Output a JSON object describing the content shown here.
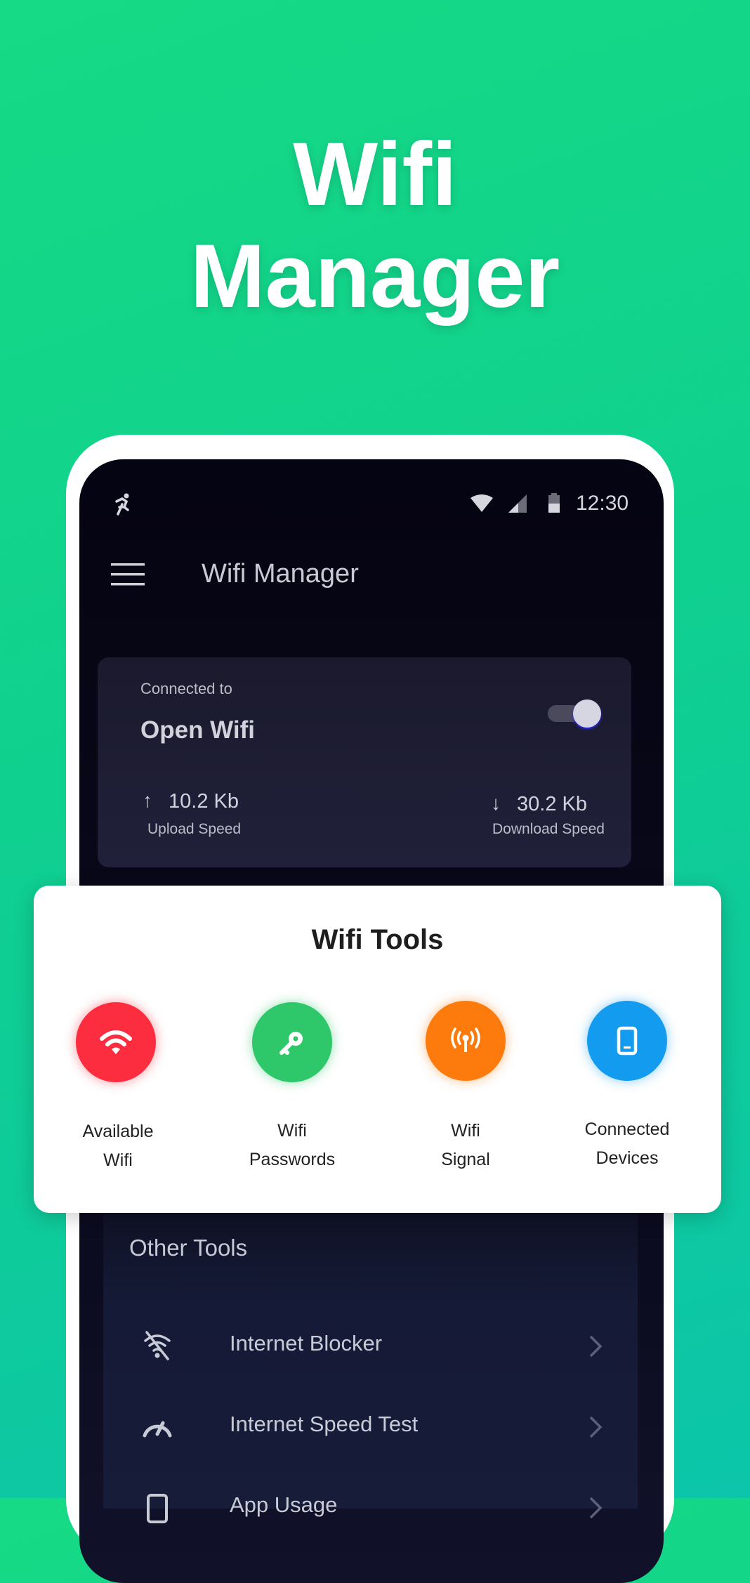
{
  "hero": {
    "line1": "Wifi",
    "line2": "Manager"
  },
  "status_bar": {
    "time": "12:30",
    "icons": [
      "running-app-icon",
      "wifi-icon",
      "cellular-signal-icon",
      "battery-icon"
    ]
  },
  "app_bar": {
    "title": "Wifi Manager",
    "menu_icon": "hamburger-icon"
  },
  "connection": {
    "label": "Connected to",
    "network": "Open Wifi",
    "toggle_on": true,
    "upload": {
      "value": "10.2 Kb",
      "label": "Upload Speed"
    },
    "download": {
      "value": "30.2 Kb",
      "label": "Download Speed"
    }
  },
  "wifi_tools": {
    "title": "Wifi Tools",
    "items": [
      {
        "line1": "Available",
        "line2": "Wifi",
        "color": "#fb2d3e",
        "icon": "wifi-icon"
      },
      {
        "line1": "Wifi",
        "line2": "Passwords",
        "color": "#2ec76a",
        "icon": "key-icon"
      },
      {
        "line1": "Wifi",
        "line2": "Signal",
        "color": "#fd7a0c",
        "icon": "antenna-signal-icon"
      },
      {
        "line1": "Connected",
        "line2": "Devices",
        "color": "#139bf0",
        "icon": "phone-icon"
      }
    ]
  },
  "other_tools": {
    "title": "Other Tools",
    "items": [
      {
        "label": "Internet Blocker",
        "icon": "wifi-off-icon"
      },
      {
        "label": "Internet Speed Test",
        "icon": "speedometer-icon"
      },
      {
        "label": "App Usage",
        "icon": "phone-icon"
      }
    ]
  }
}
